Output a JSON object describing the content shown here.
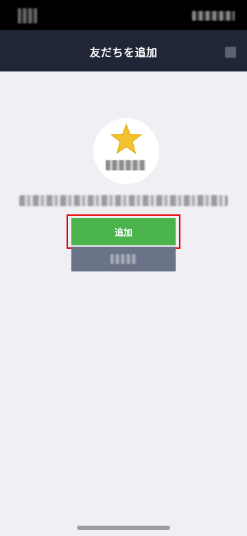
{
  "header": {
    "title": "友だちを追加"
  },
  "actions": {
    "add_label": "追加",
    "add_color": "#4bb34b",
    "highlight_color": "#e60000"
  },
  "icons": {
    "profile_icon": "star-icon"
  }
}
